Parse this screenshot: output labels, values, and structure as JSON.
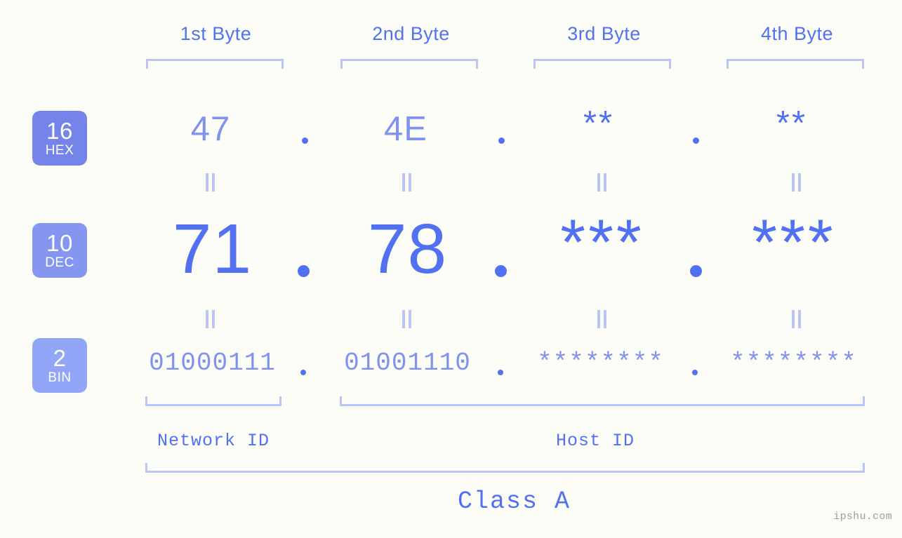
{
  "background_color": "#fcfdf7",
  "accent_strong": "#5271f2",
  "accent_mid": "#8192ee",
  "accent_light": "#bac5f5",
  "byte_headers": [
    {
      "label": "1st Byte"
    },
    {
      "label": "2nd Byte"
    },
    {
      "label": "3rd Byte"
    },
    {
      "label": "4th Byte"
    }
  ],
  "bases": [
    {
      "number": "16",
      "name": "HEX",
      "color": "#7584e8"
    },
    {
      "number": "10",
      "name": "DEC",
      "color": "#8496f0"
    },
    {
      "number": "2",
      "name": "BIN",
      "color": "#92a6f7"
    }
  ],
  "rows": {
    "hex": {
      "base_number": "16",
      "base_name": "HEX",
      "values": [
        "47",
        "4E",
        "**",
        "**"
      ],
      "separator": "."
    },
    "dec": {
      "base_number": "10",
      "base_name": "DEC",
      "values": [
        "71",
        "78",
        "***",
        "***"
      ],
      "separator": "."
    },
    "bin": {
      "base_number": "2",
      "base_name": "BIN",
      "values": [
        "01000111",
        "01001110",
        "********",
        "********"
      ],
      "separator": "."
    }
  },
  "equality_symbol": "||",
  "segments": {
    "network_id": "Network ID",
    "host_id": "Host ID",
    "class": "Class A"
  },
  "watermark": "ipshu.com"
}
